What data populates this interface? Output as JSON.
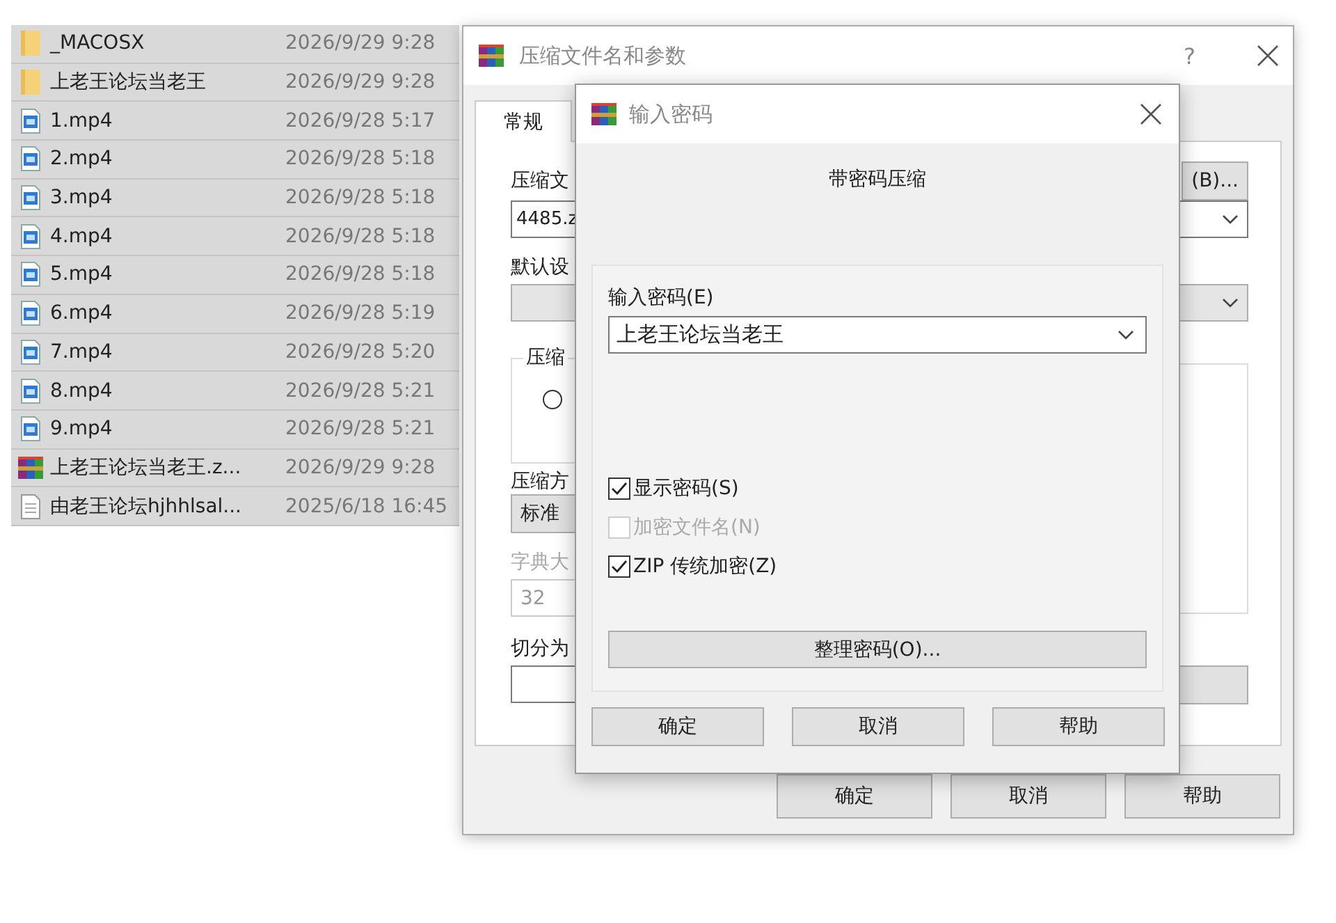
{
  "file_list": [
    {
      "name": "_MACOSX",
      "modified": "2026/9/29 9:28",
      "kind": "folder",
      "selected": true
    },
    {
      "name": "上老王论坛当老王",
      "modified": "2026/9/29 9:28",
      "kind": "folder",
      "selected": true
    },
    {
      "name": "1.mp4",
      "modified": "2026/9/28 5:17",
      "kind": "video",
      "selected": true
    },
    {
      "name": "2.mp4",
      "modified": "2026/9/28 5:18",
      "kind": "video",
      "selected": true
    },
    {
      "name": "3.mp4",
      "modified": "2026/9/28 5:18",
      "kind": "video",
      "selected": true
    },
    {
      "name": "4.mp4",
      "modified": "2026/9/28 5:18",
      "kind": "video",
      "selected": true
    },
    {
      "name": "5.mp4",
      "modified": "2026/9/28 5:18",
      "kind": "video",
      "selected": true
    },
    {
      "name": "6.mp4",
      "modified": "2026/9/28 5:19",
      "kind": "video",
      "selected": true
    },
    {
      "name": "7.mp4",
      "modified": "2026/9/28 5:20",
      "kind": "video",
      "selected": true
    },
    {
      "name": "8.mp4",
      "modified": "2026/9/28 5:21",
      "kind": "video",
      "selected": true
    },
    {
      "name": "9.mp4",
      "modified": "2026/9/28 5:21",
      "kind": "video",
      "selected": true
    },
    {
      "name": "上老王论坛当老王.z...",
      "modified": "2026/9/29 9:28",
      "kind": "archive",
      "selected": true
    },
    {
      "name": "由老王论坛hjhhlsal...",
      "modified": "2025/6/18 16:45",
      "kind": "text",
      "selected": true
    }
  ],
  "archive_dialog": {
    "title": "压缩文件名和参数",
    "help_glyph": "?",
    "tabs": [
      {
        "label": "常规",
        "selected": true
      }
    ],
    "archive_name_label": "压缩文",
    "archive_name_value": "4485.z",
    "browse_button": "(B)...",
    "profile_label": "默认设",
    "format_group_label": "压缩",
    "format_radio_selected": false,
    "method_label": "压缩方",
    "method_value": "标准",
    "dictionary_label": "字典大",
    "dictionary_value": "32",
    "dictionary_disabled": true,
    "split_label": "切分为",
    "buttons": [
      "确定",
      "取消",
      "帮助"
    ]
  },
  "password_dialog": {
    "title": "输入密码",
    "heading": "带密码压缩",
    "password_label": "输入密码(E)",
    "password_value": "上老王论坛当老王",
    "options": [
      {
        "label": "显示密码(S)",
        "checked": true,
        "disabled": false
      },
      {
        "label": "加密文件名(N)",
        "checked": false,
        "disabled": true
      },
      {
        "label": "ZIP 传统加密(Z)",
        "checked": true,
        "disabled": false
      }
    ],
    "organize_button": "整理密码(O)...",
    "buttons": [
      "确定",
      "取消",
      "帮助"
    ]
  }
}
